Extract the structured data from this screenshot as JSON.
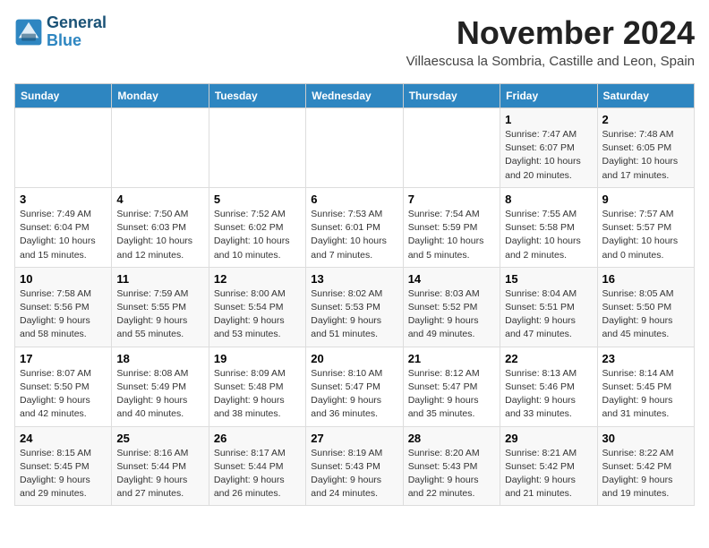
{
  "logo": {
    "line1": "General",
    "line2": "Blue"
  },
  "title": "November 2024",
  "location": "Villaescusa la Sombria, Castille and Leon, Spain",
  "weekdays": [
    "Sunday",
    "Monday",
    "Tuesday",
    "Wednesday",
    "Thursday",
    "Friday",
    "Saturday"
  ],
  "weeks": [
    [
      {
        "day": "",
        "info": ""
      },
      {
        "day": "",
        "info": ""
      },
      {
        "day": "",
        "info": ""
      },
      {
        "day": "",
        "info": ""
      },
      {
        "day": "",
        "info": ""
      },
      {
        "day": "1",
        "info": "Sunrise: 7:47 AM\nSunset: 6:07 PM\nDaylight: 10 hours and 20 minutes."
      },
      {
        "day": "2",
        "info": "Sunrise: 7:48 AM\nSunset: 6:05 PM\nDaylight: 10 hours and 17 minutes."
      }
    ],
    [
      {
        "day": "3",
        "info": "Sunrise: 7:49 AM\nSunset: 6:04 PM\nDaylight: 10 hours and 15 minutes."
      },
      {
        "day": "4",
        "info": "Sunrise: 7:50 AM\nSunset: 6:03 PM\nDaylight: 10 hours and 12 minutes."
      },
      {
        "day": "5",
        "info": "Sunrise: 7:52 AM\nSunset: 6:02 PM\nDaylight: 10 hours and 10 minutes."
      },
      {
        "day": "6",
        "info": "Sunrise: 7:53 AM\nSunset: 6:01 PM\nDaylight: 10 hours and 7 minutes."
      },
      {
        "day": "7",
        "info": "Sunrise: 7:54 AM\nSunset: 5:59 PM\nDaylight: 10 hours and 5 minutes."
      },
      {
        "day": "8",
        "info": "Sunrise: 7:55 AM\nSunset: 5:58 PM\nDaylight: 10 hours and 2 minutes."
      },
      {
        "day": "9",
        "info": "Sunrise: 7:57 AM\nSunset: 5:57 PM\nDaylight: 10 hours and 0 minutes."
      }
    ],
    [
      {
        "day": "10",
        "info": "Sunrise: 7:58 AM\nSunset: 5:56 PM\nDaylight: 9 hours and 58 minutes."
      },
      {
        "day": "11",
        "info": "Sunrise: 7:59 AM\nSunset: 5:55 PM\nDaylight: 9 hours and 55 minutes."
      },
      {
        "day": "12",
        "info": "Sunrise: 8:00 AM\nSunset: 5:54 PM\nDaylight: 9 hours and 53 minutes."
      },
      {
        "day": "13",
        "info": "Sunrise: 8:02 AM\nSunset: 5:53 PM\nDaylight: 9 hours and 51 minutes."
      },
      {
        "day": "14",
        "info": "Sunrise: 8:03 AM\nSunset: 5:52 PM\nDaylight: 9 hours and 49 minutes."
      },
      {
        "day": "15",
        "info": "Sunrise: 8:04 AM\nSunset: 5:51 PM\nDaylight: 9 hours and 47 minutes."
      },
      {
        "day": "16",
        "info": "Sunrise: 8:05 AM\nSunset: 5:50 PM\nDaylight: 9 hours and 45 minutes."
      }
    ],
    [
      {
        "day": "17",
        "info": "Sunrise: 8:07 AM\nSunset: 5:50 PM\nDaylight: 9 hours and 42 minutes."
      },
      {
        "day": "18",
        "info": "Sunrise: 8:08 AM\nSunset: 5:49 PM\nDaylight: 9 hours and 40 minutes."
      },
      {
        "day": "19",
        "info": "Sunrise: 8:09 AM\nSunset: 5:48 PM\nDaylight: 9 hours and 38 minutes."
      },
      {
        "day": "20",
        "info": "Sunrise: 8:10 AM\nSunset: 5:47 PM\nDaylight: 9 hours and 36 minutes."
      },
      {
        "day": "21",
        "info": "Sunrise: 8:12 AM\nSunset: 5:47 PM\nDaylight: 9 hours and 35 minutes."
      },
      {
        "day": "22",
        "info": "Sunrise: 8:13 AM\nSunset: 5:46 PM\nDaylight: 9 hours and 33 minutes."
      },
      {
        "day": "23",
        "info": "Sunrise: 8:14 AM\nSunset: 5:45 PM\nDaylight: 9 hours and 31 minutes."
      }
    ],
    [
      {
        "day": "24",
        "info": "Sunrise: 8:15 AM\nSunset: 5:45 PM\nDaylight: 9 hours and 29 minutes."
      },
      {
        "day": "25",
        "info": "Sunrise: 8:16 AM\nSunset: 5:44 PM\nDaylight: 9 hours and 27 minutes."
      },
      {
        "day": "26",
        "info": "Sunrise: 8:17 AM\nSunset: 5:44 PM\nDaylight: 9 hours and 26 minutes."
      },
      {
        "day": "27",
        "info": "Sunrise: 8:19 AM\nSunset: 5:43 PM\nDaylight: 9 hours and 24 minutes."
      },
      {
        "day": "28",
        "info": "Sunrise: 8:20 AM\nSunset: 5:43 PM\nDaylight: 9 hours and 22 minutes."
      },
      {
        "day": "29",
        "info": "Sunrise: 8:21 AM\nSunset: 5:42 PM\nDaylight: 9 hours and 21 minutes."
      },
      {
        "day": "30",
        "info": "Sunrise: 8:22 AM\nSunset: 5:42 PM\nDaylight: 9 hours and 19 minutes."
      }
    ]
  ]
}
